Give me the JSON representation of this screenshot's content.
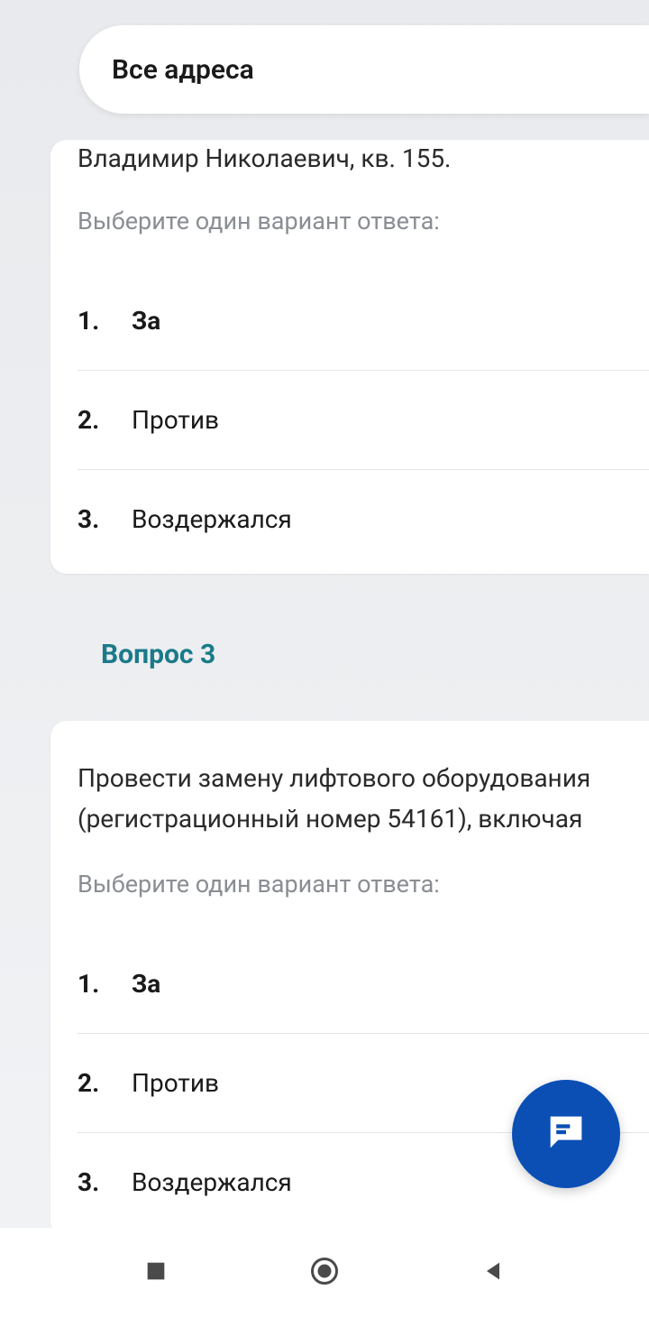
{
  "header": {
    "label": "Все адреса"
  },
  "questions": [
    {
      "partial_text": "Владимир Николаевич, кв. 155.",
      "instruction": "Выберите один вариант ответа:",
      "options": [
        {
          "num": "1.",
          "text": "За",
          "bold": true
        },
        {
          "num": "2.",
          "text": "Против",
          "bold": false
        },
        {
          "num": "3.",
          "text": "Воздержался",
          "bold": false
        }
      ]
    },
    {
      "heading": "Вопрос 3",
      "partial_text": "Провести замену лифтового оборудования (регистрационный номер 54161), включая",
      "instruction": "Выберите один вариант ответа:",
      "options": [
        {
          "num": "1.",
          "text": "За",
          "bold": true
        },
        {
          "num": "2.",
          "text": "Против",
          "bold": false
        },
        {
          "num": "3.",
          "text": "Воздержался",
          "bold": false
        }
      ]
    }
  ]
}
